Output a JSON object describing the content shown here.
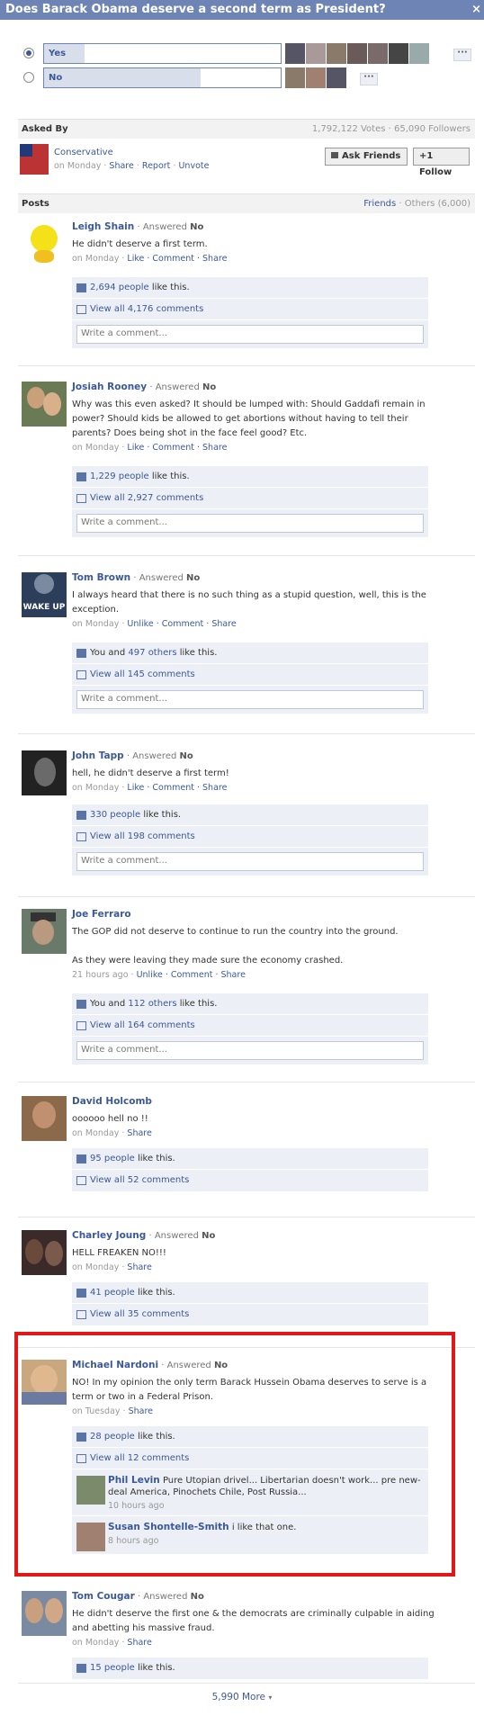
{
  "question": {
    "title": "Does Barack Obama deserve a second term as President?",
    "close": "×"
  },
  "options": [
    {
      "label": "Yes",
      "fill": 0.17,
      "selected": true,
      "more": "···"
    },
    {
      "label": "No",
      "fill": 0.66,
      "selected": false,
      "more": "···"
    }
  ],
  "asked": {
    "section_label": "Asked By",
    "stats": "1,792,122 Votes · 65,090 Followers",
    "author": "Conservative",
    "when": "on Monday",
    "share": "Share",
    "report": "Report",
    "unvote": "Unvote",
    "ask_friends": "Ask Friends",
    "follow": "Follow",
    "follow_prefix": "+1"
  },
  "posts_header": {
    "label": "Posts",
    "friends": "Friends",
    "others": "Others (6,000)"
  },
  "posts": [
    {
      "name": "Leigh Shain",
      "answered": "Answered",
      "answer": "No",
      "text": "He didn't deserve a first term.",
      "when": "on Monday",
      "actions": "Like · Comment · Share",
      "likes_link": "2,694 people",
      "likes_suffix": " like this.",
      "comments": "View all 4,176 comments",
      "placeholder": "Write a comment..."
    },
    {
      "name": "Josiah Rooney",
      "answered": "Answered",
      "answer": "No",
      "text": "Why was this even asked? It should be lumped with: Should Gaddafi remain in power? Should kids be allowed to get abortions without having to tell their parents? Does being shot in the face feel good? Etc.",
      "when": "on Monday",
      "actions": "Like · Comment · Share",
      "likes_link": "1,229 people",
      "likes_suffix": " like this.",
      "comments": "View all 2,927 comments",
      "placeholder": "Write a comment..."
    },
    {
      "name": "Tom Brown",
      "answered": "Answered",
      "answer": "No",
      "text": "I always heard that there is no such thing as a stupid question, well, this is the exception.",
      "when": "on Monday",
      "actions": "Unlike · Comment · Share",
      "likes_prefix": "You and ",
      "likes_link": "497 others",
      "likes_suffix": " like this.",
      "comments": "View all 145 comments",
      "placeholder": "Write a comment...",
      "avatar_text": "WAKE UP"
    },
    {
      "name": "John Tapp",
      "answered": "Answered",
      "answer": "No",
      "text": "hell, he didn't deserve a first term!",
      "when": "on Monday",
      "actions": "Like · Comment · Share",
      "likes_link": "330 people",
      "likes_suffix": " like this.",
      "comments": "View all 198 comments",
      "placeholder": "Write a comment..."
    },
    {
      "name": "Joe Ferraro",
      "text": "The GOP did not deserve to continue to run the country into the ground.",
      "text2": "As they were leaving they made sure the economy crashed.",
      "when": "21 hours ago",
      "actions": "Unlike · Comment · Share",
      "likes_prefix": "You and ",
      "likes_link": "112 others",
      "likes_suffix": " like this.",
      "comments": "View all 164 comments",
      "placeholder": "Write a comment..."
    },
    {
      "name": "David Holcomb",
      "text": "oooooo hell no !!",
      "when": "on Monday",
      "actions": "Share",
      "likes_link": "95 people",
      "likes_suffix": " like this.",
      "comments": "View all 52 comments"
    },
    {
      "name": "Charley Joung",
      "answered": "Answered",
      "answer": "No",
      "text": "HELL FREAKEN NO!!!",
      "when": "on Monday",
      "actions": "Share",
      "likes_link": "41 people",
      "likes_suffix": " like this.",
      "comments": "View all 35 comments"
    },
    {
      "name": "Michael Nardoni",
      "answered": "Answered",
      "answer": "No",
      "text": "NO! In my opinion the only term Barack Hussein Obama deserves to serve is a term or two in a Federal Prison.",
      "when": "on Tuesday",
      "actions": "Share",
      "likes_link": "28 people",
      "likes_suffix": " like this.",
      "comments": "View all 12 comments",
      "replies": [
        {
          "name": "Phil Levin",
          "text": "Pure Utopian drivel... Libertarian doesn't work... pre new-deal America, Pinochets Chile, Post Russia...",
          "when": "10 hours ago"
        },
        {
          "name": "Susan Shontelle-Smith",
          "text": "i like that one.",
          "when": "8 hours ago"
        }
      ]
    },
    {
      "name": "Tom Cougar",
      "answered": "Answered",
      "answer": "No",
      "text": "He didn't deserve the first one & the democrats are criminally culpable in aiding and abetting his massive fraud.",
      "when": "on Monday",
      "actions": "Share",
      "likes_link": "15 people",
      "likes_suffix": " like this."
    }
  ],
  "footer": {
    "more": "5,990 More",
    "arrow": "▾"
  },
  "colors": {
    "header": "#6d84b4",
    "link": "#3b5998",
    "highlight": "#e01818"
  }
}
